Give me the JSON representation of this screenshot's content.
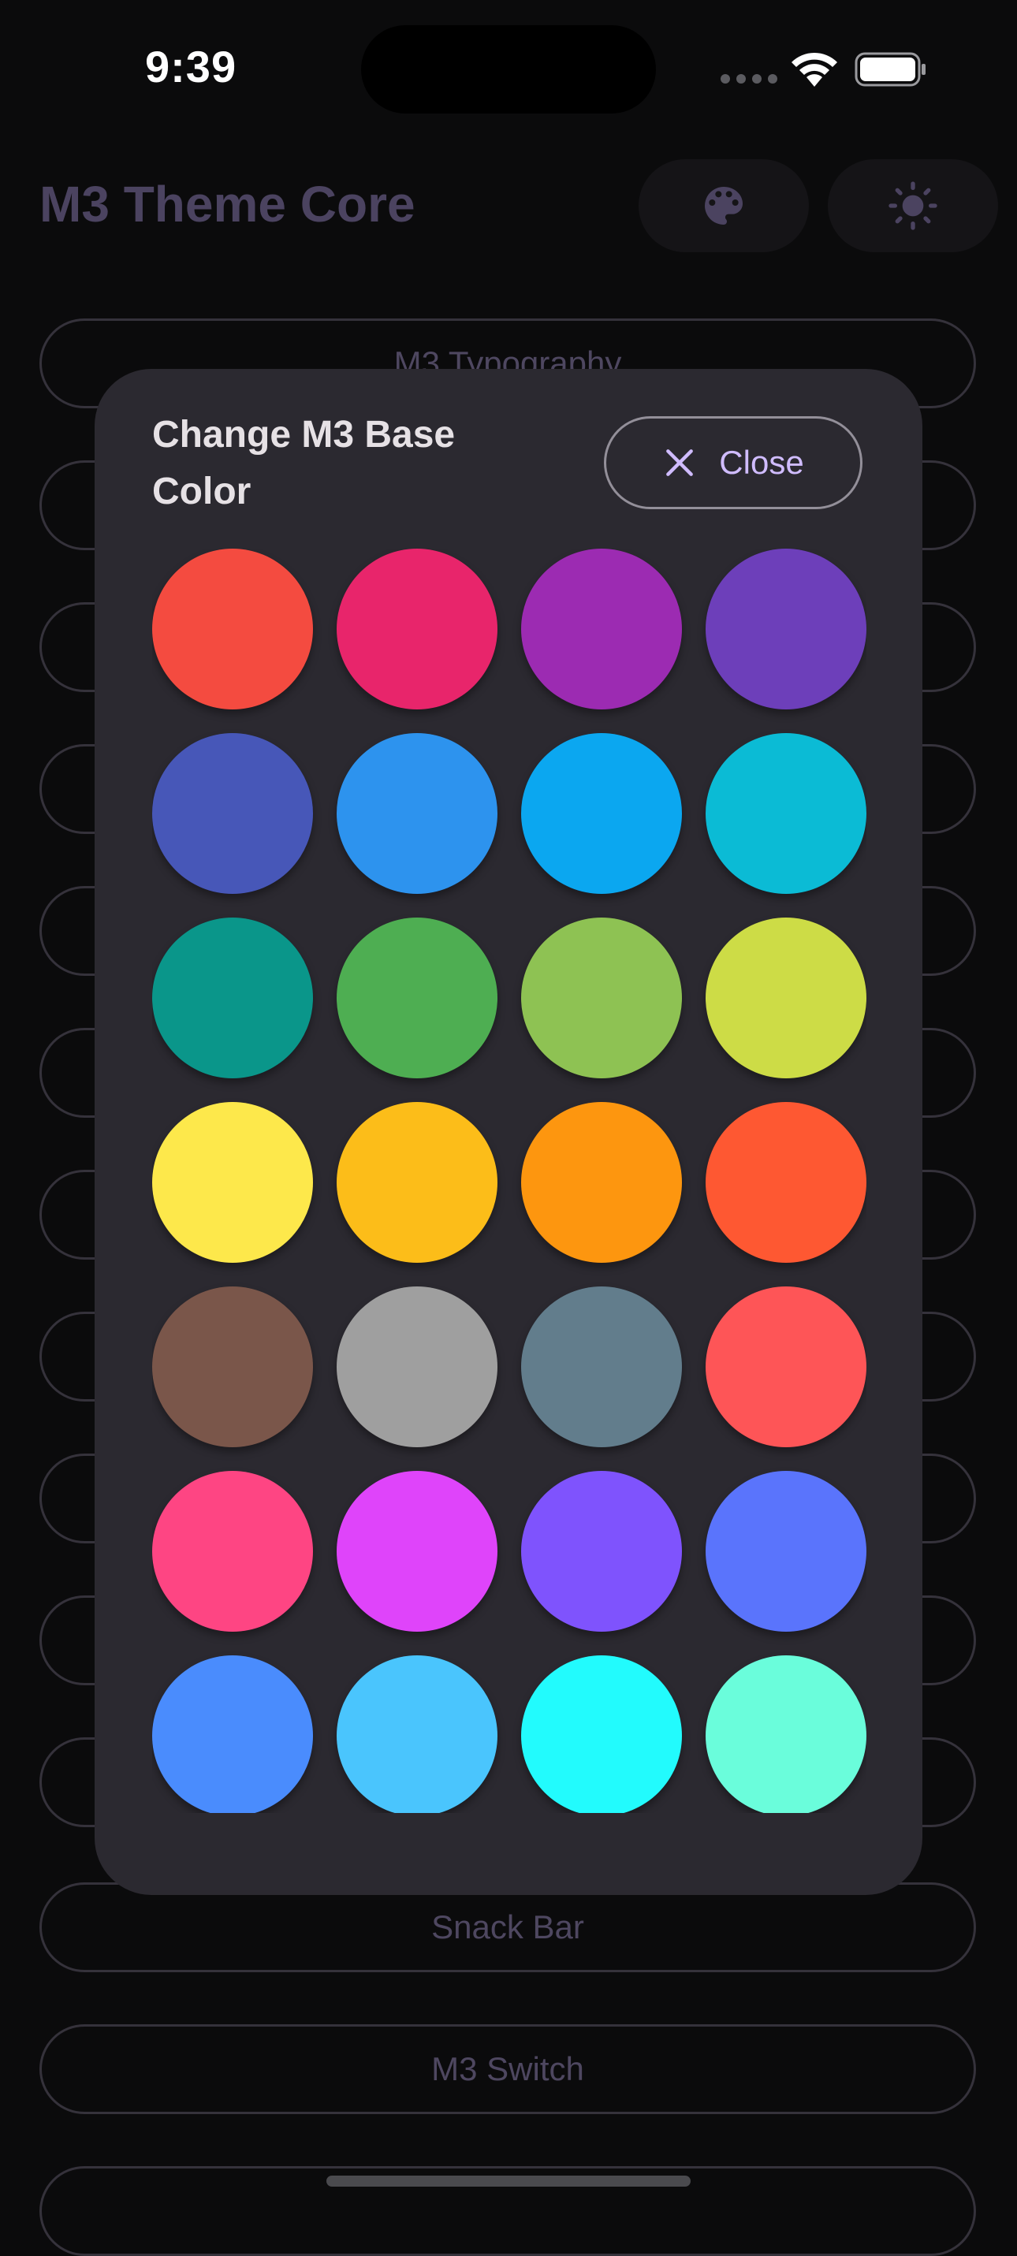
{
  "status_bar": {
    "time": "9:39",
    "wifi_icon": "wifi-icon",
    "battery_icon": "battery-icon"
  },
  "app_bar": {
    "title": "M3 Theme Core",
    "palette_icon": "palette-icon",
    "theme_icon": "brightness-icon"
  },
  "background_list": {
    "items": [
      {
        "label": "M3 Typography"
      },
      {
        "label": ""
      },
      {
        "label": ""
      },
      {
        "label": ""
      },
      {
        "label": ""
      },
      {
        "label": ""
      },
      {
        "label": ""
      },
      {
        "label": ""
      },
      {
        "label": ""
      },
      {
        "label": ""
      },
      {
        "label": ""
      },
      {
        "label": "Snack Bar"
      },
      {
        "label": "M3 Switch"
      }
    ]
  },
  "dialog": {
    "title": "Change M3 Base Color",
    "close_label": "Close",
    "close_icon": "close-icon",
    "colors": [
      "#f44b40",
      "#e8256b",
      "#9c2bb2",
      "#6d3fba",
      "#4757b8",
      "#2d93ee",
      "#0ba7f0",
      "#0bbbd5",
      "#0a968a",
      "#4eae52",
      "#8ec253",
      "#cddc46",
      "#fde84b",
      "#fcbd19",
      "#fd960f",
      "#fe5832",
      "#7a564a",
      "#9f9f9f",
      "#627d8c",
      "#fe5557",
      "#fe4583",
      "#df44fa",
      "#7f53fd",
      "#5a74fc",
      "#4a8cfd",
      "#4ac5fd",
      "#22fbfd",
      "#6afddb"
    ]
  }
}
